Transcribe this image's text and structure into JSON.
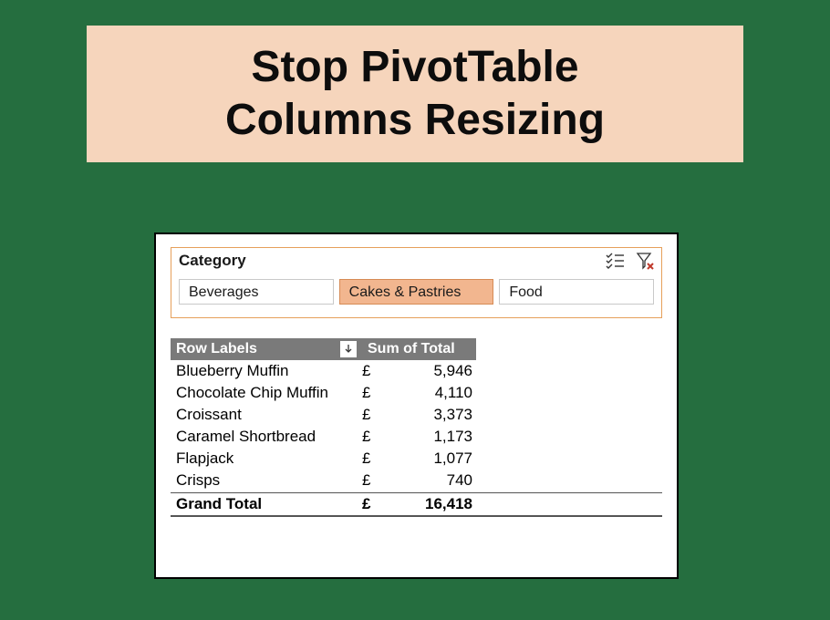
{
  "title": {
    "line1": "Stop PivotTable",
    "line2": "Columns Resizing"
  },
  "slicer": {
    "label": "Category",
    "items": [
      {
        "label": "Beverages",
        "selected": false
      },
      {
        "label": "Cakes & Pastries",
        "selected": true
      },
      {
        "label": "Food",
        "selected": false
      }
    ]
  },
  "pivot": {
    "headers": {
      "rowlabels": "Row Labels",
      "sum": "Sum of Total"
    },
    "currency": "£",
    "rows": [
      {
        "label": "Blueberry Muffin",
        "value": "5,946"
      },
      {
        "label": "Chocolate Chip Muffin",
        "value": "4,110"
      },
      {
        "label": "Croissant",
        "value": "3,373"
      },
      {
        "label": "Caramel Shortbread",
        "value": "1,173"
      },
      {
        "label": "Flapjack",
        "value": "1,077"
      },
      {
        "label": "Crisps",
        "value": "740"
      }
    ],
    "total": {
      "label": "Grand Total",
      "value": "16,418"
    }
  },
  "chart_data": {
    "type": "table",
    "title": "Sum of Total by Row Labels (Category: Cakes & Pastries)",
    "categories": [
      "Blueberry Muffin",
      "Chocolate Chip Muffin",
      "Croissant",
      "Caramel Shortbread",
      "Flapjack",
      "Crisps"
    ],
    "values": [
      5946,
      4110,
      3373,
      1173,
      1077,
      740
    ],
    "grand_total": 16418,
    "currency": "GBP"
  }
}
